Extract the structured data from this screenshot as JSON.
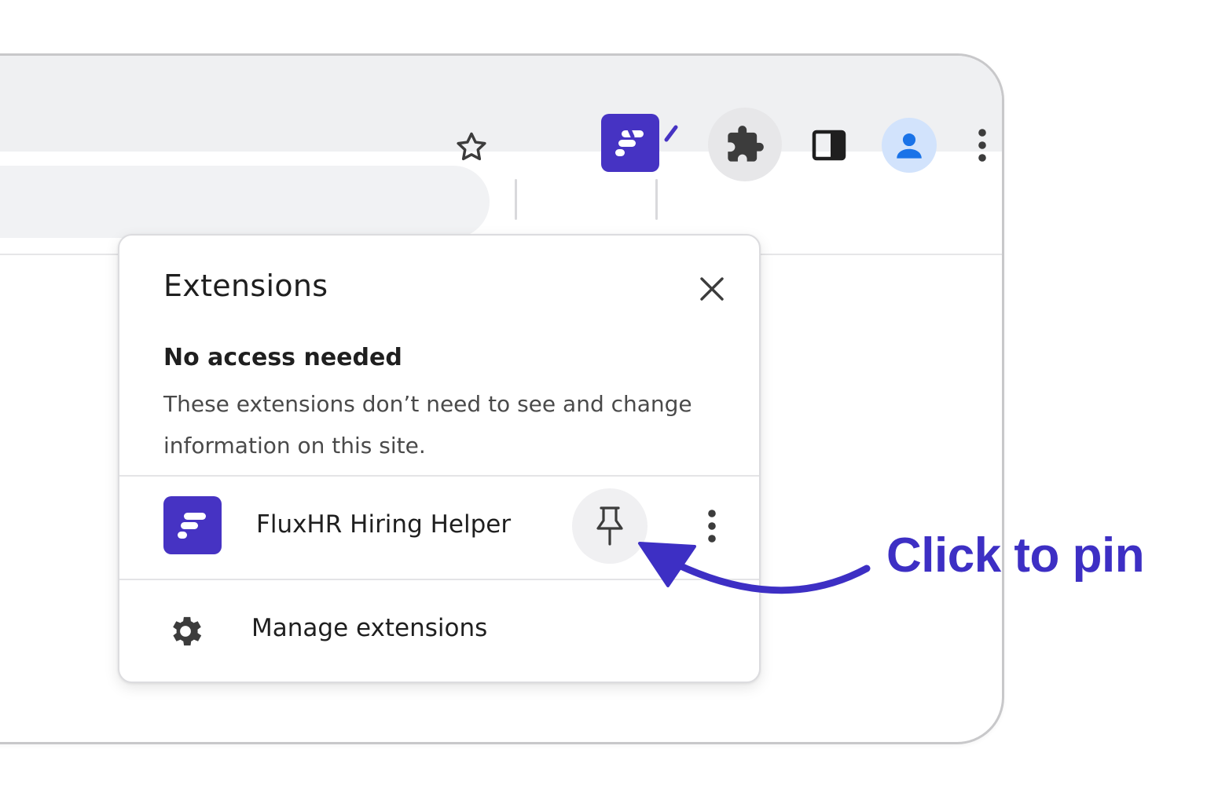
{
  "toolbar": {
    "bookmark_icon": "star-icon",
    "pinned_extension_icon": "fluxhr-logo-icon",
    "extensions_icon": "puzzle-icon",
    "side_panel_icon": "side-panel-icon",
    "profile_icon": "person-icon",
    "menu_icon": "three-dots-vertical-icon"
  },
  "popup": {
    "title": "Extensions",
    "close_icon": "close-icon",
    "section": {
      "heading": "No access needed",
      "description": "These extensions don’t need to see and change information on this site."
    },
    "extensions": [
      {
        "name": "FluxHR Hiring Helper",
        "icon": "fluxhr-logo-icon",
        "pin_icon": "pin-icon",
        "menu_icon": "three-dots-vertical-icon"
      }
    ],
    "manage": {
      "label": "Manage extensions",
      "icon": "gear-icon"
    }
  },
  "annotation": {
    "text": "Click to pin",
    "arrow_icon": "curved-arrow-icon"
  },
  "colors": {
    "accent": "#4633c3",
    "annotation": "#3d2fc4",
    "avatar_bg": "#d2e3fc",
    "avatar_fg": "#1a73e8"
  }
}
